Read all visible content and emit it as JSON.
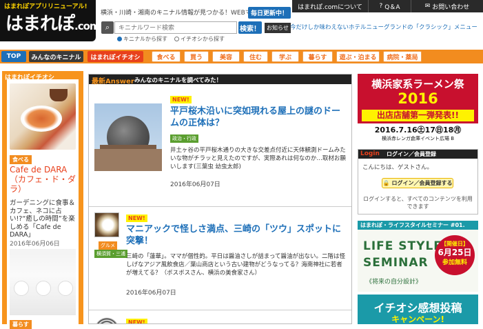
{
  "header": {
    "logo_ribbon": "はまれぽアプリリニューアル!",
    "logo_text": "はまれぽ",
    "logo_suffix": ".com",
    "tagline": "横浜・川崎・湘南のキニナル情報が見つかる！WEBマガジン",
    "daily_badge": "毎日更新中！",
    "top_links": [
      "はまれぽ.comについて",
      "Q＆A",
      "お問い合わせ"
    ],
    "search": {
      "placeholder": "キニナルワード検索",
      "button": "検索！",
      "options": [
        "キニナルから探す",
        "イチオシから探す"
      ]
    },
    "notice_badge": "お知らせ",
    "notice_text": "今だけしか味わえないホテルニューグランドの「クラシック」メニュー"
  },
  "nav": {
    "top": "TOP",
    "mine": "みんなのキニナル",
    "ichioshi": "はまれぽイチオシ",
    "categories": [
      "食べる",
      "買う",
      "美容",
      "住む",
      "学ぶ",
      "暮らす",
      "遊ぶ・泊まる",
      "病院・薬局"
    ]
  },
  "left_sidebar": {
    "header": "はまれぽイチオシ",
    "badge": "食べる",
    "title": "Cafe de DARA（カフェ・ド・ダラ）",
    "desc": "ガーデニングに食事＆カフェ、ネコに占い!?“癒しの時間”を楽しめる「Cafe de DARA」",
    "date": "2016年06月06日",
    "badge2": "暮らす"
  },
  "main": {
    "header_brand": "最新Answer",
    "header_title": "みんなのキニナルを調べてみた！",
    "articles": [
      {
        "new": "NEW!",
        "title": "平戸桜木沿いに突如現れる屋上の謎のドームの正体は？",
        "category": "政治・行政",
        "desc": "井土ヶ谷の平戸桜木通りの大きな交差点付近に天体観測ドームみたいな物がチラッと見えたのですが、実際あれは何なのか…取材お願いします(三葉虫 幼虫太郎)",
        "date": "2016年06月07日"
      },
      {
        "new": "NEW!",
        "title": "マニアックで怪しさ満点、三崎の「ツウ」スポットに突撃！",
        "category": "グルメ",
        "category2": "横須賀・三浦",
        "desc": "三崎の「蓮華」。ママが個性的。平日は醤油さしが詰まって醤油が出ない。二階は怪しげなアジア風飲食店／葉山商店という古い建物がどうなってる？海南神社に若者が増えてる？（ボスボスさん、横浜の美食家さん）",
        "date": "2016年06月07日"
      },
      {
        "new": "NEW!"
      }
    ]
  },
  "right_sidebar": {
    "ramen": {
      "title": "横浜家系ラーメン祭",
      "year": "2016",
      "sub": "出店店舗第一弾発表!!",
      "dates": "2016.7.16㊏17㊐18㊊",
      "venue": "横浜赤レンガ倉庫イベント広場 B"
    },
    "login": {
      "header_l": "Login",
      "header_r": "ログイン／会員登録",
      "guest": "こんにちは、ゲストさん。",
      "button": "ログイン／会員登録する",
      "note": "ログインすると、すべてのコンテンツを利用できます"
    },
    "seminar": {
      "header": "はまれぽ・ライフスタイルセミナー #01.",
      "line1": "LIFE STYLE",
      "line2": "SEMINAR",
      "line3": "《将来の自分設計》",
      "kaisai": "【開催日】",
      "date": "6月25日",
      "fee": "参加無料"
    },
    "post": {
      "title": "イチオシ感想投稿",
      "campaign": "キャンペーン!"
    }
  },
  "colors": {
    "orange": "#f28c1f",
    "blue": "#1d6fb8",
    "red": "#e8401c",
    "teal": "#1b9aa8"
  }
}
